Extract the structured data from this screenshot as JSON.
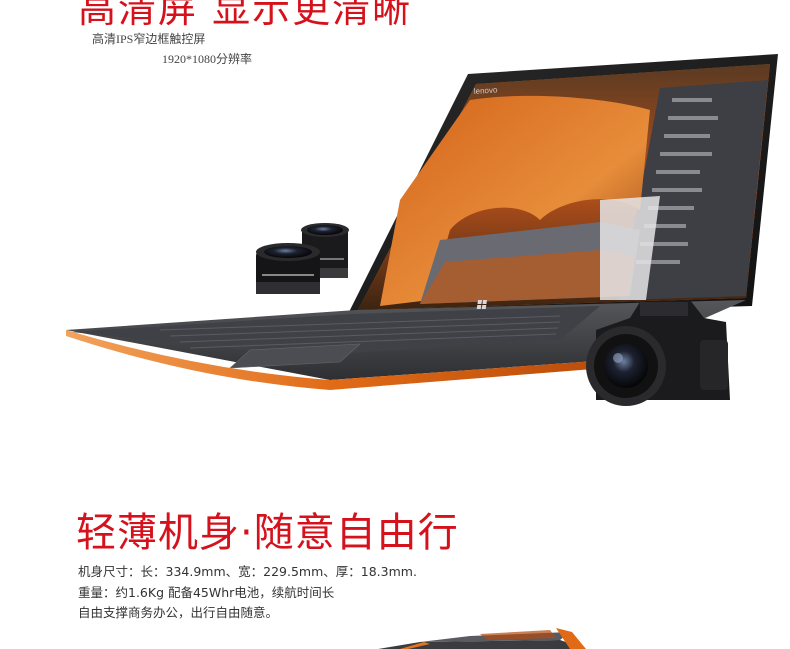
{
  "section1": {
    "title": "高清屏 显示更清晰",
    "line1": "高清IPS窄边框触控屏",
    "line2": "1920*1080分辨率"
  },
  "laptop_brand": "lenovo",
  "section2": {
    "title": "轻薄机身·随意自由行",
    "spec_size": "机身尺寸：长：334.9mm、宽：229.5mm、厚：18.3mm.",
    "spec_weight": "重量：约1.6Kg 配备45Whr电池，续航时间长",
    "spec_use": "自由支撑商务办公，出行自由随意。"
  },
  "colors": {
    "accent_red": "#d5121c",
    "laptop_orange": "#e5731f"
  }
}
